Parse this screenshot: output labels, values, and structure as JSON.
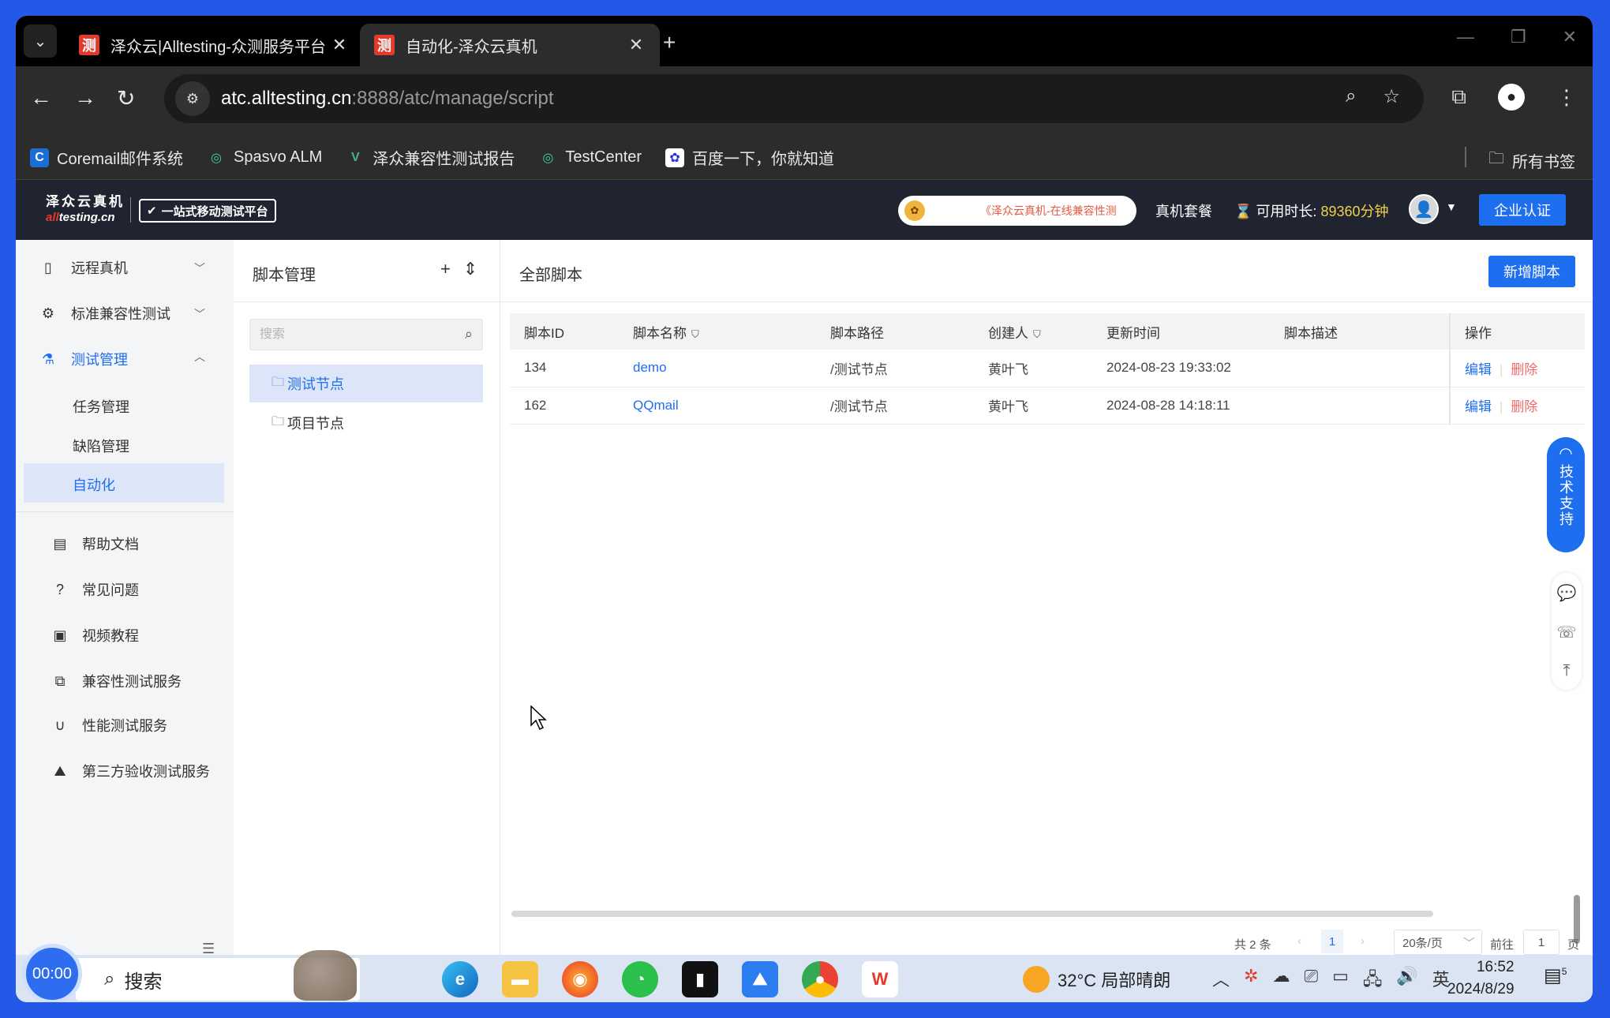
{
  "browser": {
    "tabs": [
      {
        "favicon": "测",
        "title": "泽众云|Alltesting-众测服务平台"
      },
      {
        "favicon": "测",
        "title": "自动化-泽众云真机"
      }
    ],
    "url_host": "atc.alltesting.cn",
    "url_rest": ":8888/atc/manage/script",
    "bookmarks": [
      {
        "icon": "C",
        "label": "Coremail邮件系统"
      },
      {
        "icon": "◎",
        "label": "Spasvo ALM"
      },
      {
        "icon": "V",
        "label": "泽众兼容性测试报告"
      },
      {
        "icon": "◎",
        "label": "TestCenter"
      },
      {
        "icon": "✿",
        "label": "百度一下，你就知道"
      }
    ],
    "all_bookmarks": "所有书签"
  },
  "header": {
    "logo_top": "泽众云真机",
    "logo_prefix": "all",
    "logo_suffix": "testing.cn",
    "slogan": "一站式移动测试平台",
    "marquee": "《泽众云真机-在线兼容性测",
    "plan_link": "真机套餐",
    "avail_label": "可用时长:",
    "avail_value": "89360分钟",
    "cert_button": "企业认证"
  },
  "sidebar": {
    "items": [
      {
        "label": "远程真机"
      },
      {
        "label": "标准兼容性测试"
      },
      {
        "label": "测试管理"
      }
    ],
    "sub_items": [
      "任务管理",
      "缺陷管理",
      "自动化"
    ],
    "help_items": [
      "帮助文档",
      "常见问题",
      "视频教程",
      "兼容性测试服务",
      "性能测试服务",
      "第三方验收测试服务"
    ]
  },
  "tree": {
    "title": "脚本管理",
    "search_placeholder": "搜索",
    "nodes": [
      "测试节点",
      "项目节点"
    ]
  },
  "main": {
    "title": "全部脚本",
    "add_button": "新增脚本",
    "columns": [
      "脚本ID",
      "脚本名称",
      "脚本路径",
      "创建人",
      "更新时间",
      "脚本描述",
      "操作"
    ],
    "rows": [
      {
        "id": "134",
        "name": "demo",
        "path": "/测试节点",
        "creator": "黄叶飞",
        "updated": "2024-08-23 19:33:02",
        "desc": "",
        "edit": "编辑",
        "del": "删除"
      },
      {
        "id": "162",
        "name": "QQmail",
        "path": "/测试节点",
        "creator": "黄叶飞",
        "updated": "2024-08-28 14:18:11",
        "desc": "",
        "edit": "编辑",
        "del": "删除"
      }
    ],
    "pager": {
      "total": "共 2 条",
      "page": "1",
      "size": "20条/页",
      "goto": "前往",
      "goto_value": "1",
      "page_label": "页"
    }
  },
  "support": {
    "label": "技术支持"
  },
  "taskbar": {
    "timer": "00:00",
    "search": "搜索",
    "weather": "32°C 局部晴朗",
    "ime": "英",
    "time": "16:52",
    "date": "2024/8/29",
    "notif_count": "5"
  }
}
